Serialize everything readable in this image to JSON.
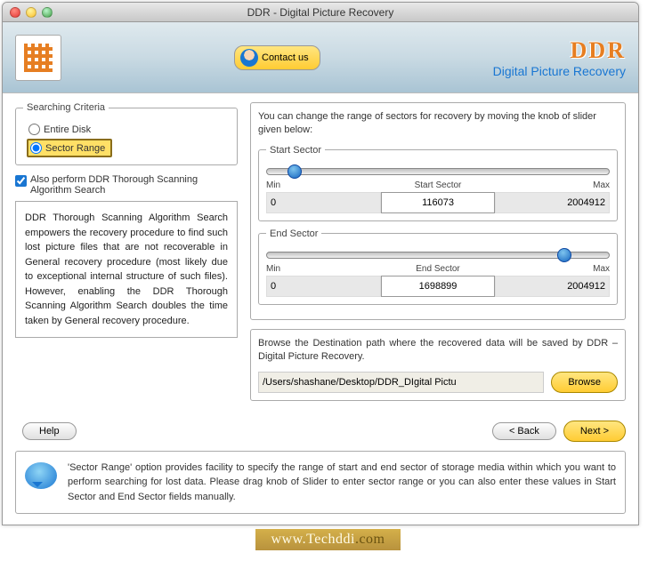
{
  "window": {
    "title": "DDR - Digital Picture Recovery"
  },
  "header": {
    "contact_label": "Contact us",
    "brand": "DDR",
    "brand_sub": "Digital Picture Recovery"
  },
  "criteria": {
    "legend": "Searching Criteria",
    "entire_disk": "Entire Disk",
    "sector_range": "Sector Range",
    "selected": "sector_range",
    "thorough_label": "Also perform DDR Thorough Scanning Algorithm Search",
    "thorough_checked": true,
    "info_text": "DDR Thorough Scanning Algorithm Search empowers the recovery procedure to find such lost picture files that are not recoverable in General recovery procedure (most likely due to exceptional internal structure of such files). However, enabling the DDR Thorough Scanning Algorithm Search doubles the time taken by General recovery procedure."
  },
  "sectors": {
    "desc": "You can change the range of sectors for recovery by moving the knob of slider given below:",
    "start": {
      "legend": "Start Sector",
      "min_label": "Min",
      "mid_label": "Start Sector",
      "max_label": "Max",
      "min": "0",
      "value": "116073",
      "max": "2004912",
      "knob_pct": 6
    },
    "end": {
      "legend": "End Sector",
      "min_label": "Min",
      "mid_label": "End Sector",
      "max_label": "Max",
      "min": "0",
      "value": "1698899",
      "max": "2004912",
      "knob_pct": 85
    }
  },
  "dest": {
    "desc": "Browse the Destination path where the recovered data will be saved by DDR – Digital Picture Recovery.",
    "path": "/Users/shashane/Desktop/DDR_DIgital Pictu",
    "browse_label": "Browse"
  },
  "nav": {
    "help": "Help",
    "back": "< Back",
    "next": "Next >"
  },
  "hint": "'Sector Range' option provides facility to specify the range of start and end sector of storage media within which you want to perform searching for lost data. Please drag knob of Slider to enter sector range or you can also enter these values in Start Sector and End Sector fields manually.",
  "watermark": {
    "domain": "www.Techddi",
    "tld": ".com"
  }
}
